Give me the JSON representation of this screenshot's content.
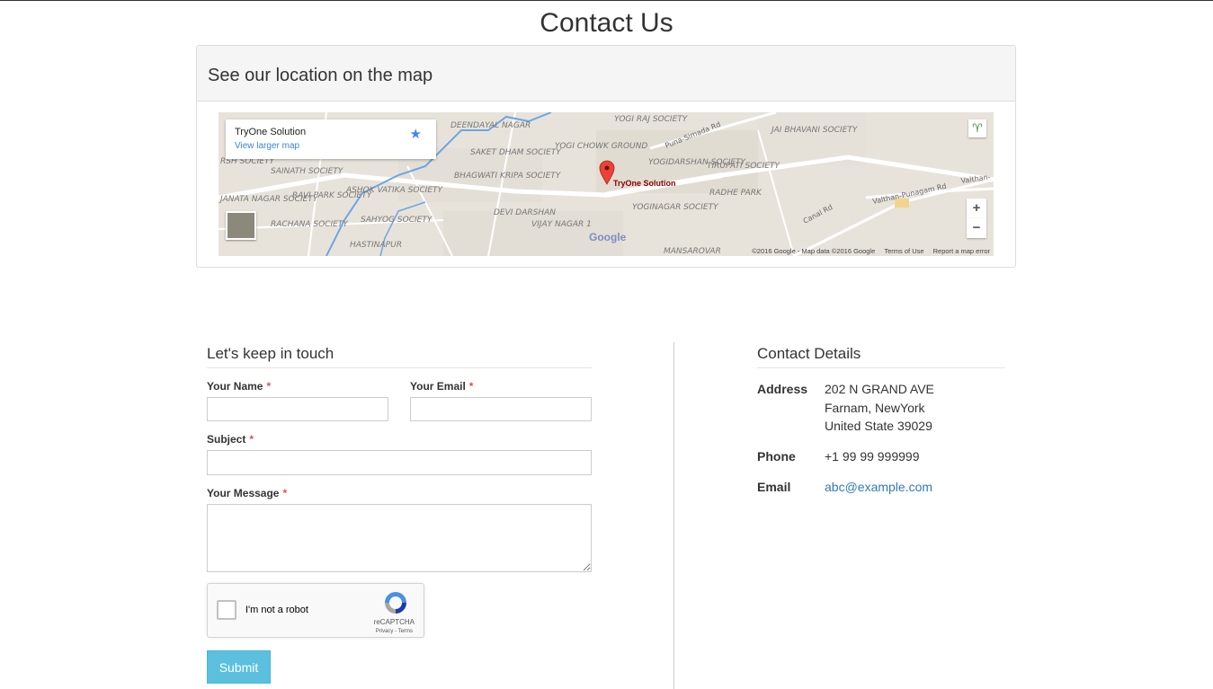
{
  "page": {
    "title": "Contact Us"
  },
  "map_panel": {
    "heading": "See our location on the map",
    "card": {
      "place_name": "TryOne Solution",
      "view_larger": "View larger map"
    },
    "pin_label": "TryOne Solution",
    "google_logo": "Google",
    "zoom_in": "+",
    "zoom_out": "−",
    "footer": {
      "copyright": "©2016 Google - Map data ©2016 Google",
      "terms": "Terms of Use",
      "report": "Report a map error"
    },
    "areas": [
      "DEENDAYAL NAGAR",
      "YOGI RAJ SOCIETY",
      "JAI BHAVANI SOCIETY",
      "YOGI CHOWK GROUND",
      "SAKET DHAM SOCIETY",
      "YOGIDARSHAN SOCIETY",
      "TIRUPATI SOCIETY",
      "SAINATH SOCIETY",
      "BHAGWATI KRIPA SOCIETY",
      "ASHOK VATIKA SOCIETY",
      "RADHE PARK",
      "RAVI PARK SOCIETY",
      "JANATA NAGAR SOCIETY",
      "DEVI DARSHAN",
      "YOGINAGAR SOCIETY",
      "RACHANA SOCIETY",
      "SAHYOG SOCIETY",
      "VIJAY NAGAR 1",
      "HASTINAPUR",
      "MANSAROVAR",
      "Puna-Simada Rd",
      "Valthan-Punagam Rd",
      "Canal Rd",
      "RSH SOCIETY",
      "Valthan-"
    ]
  },
  "form": {
    "title": "Let's keep in touch",
    "name_label": "Your Name",
    "email_label": "Your Email",
    "subject_label": "Subject",
    "message_label": "Your Message",
    "required_mark": "*",
    "captcha": {
      "text": "I'm not a robot",
      "brand": "reCAPTCHA",
      "links": "Privacy - Terms"
    },
    "submit_label": "Submit"
  },
  "contact": {
    "title": "Contact Details",
    "address_label": "Address",
    "address_line1": "202 N GRAND AVE",
    "address_line2": "Farnam, NewYork",
    "address_line3": "United State 39029",
    "phone_label": "Phone",
    "phone": "+1 99 99 999999",
    "email_label": "Email",
    "email": "abc@example.com"
  },
  "colors": {
    "primary_button": "#5bc0de",
    "link": "#337ab7",
    "required": "#d9534f"
  }
}
